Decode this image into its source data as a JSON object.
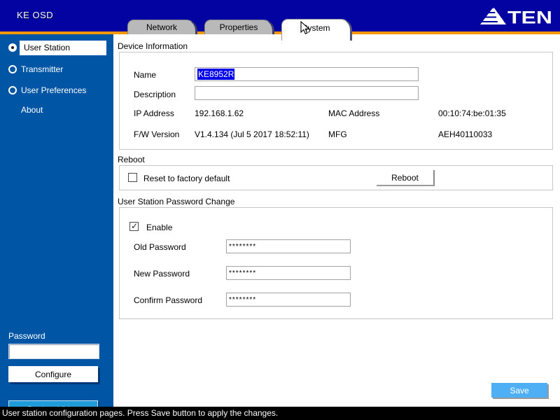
{
  "header": {
    "title": "KE OSD",
    "logo": "ATEN",
    "tabs": [
      {
        "label": "Network",
        "active": false
      },
      {
        "label": "Properties",
        "active": false
      },
      {
        "label": "System",
        "active": true
      }
    ]
  },
  "sidebar": {
    "nav": [
      {
        "label": "User Station",
        "type": "radio",
        "selected": true
      },
      {
        "label": "Transmitter",
        "type": "radio",
        "selected": false
      },
      {
        "label": "User Preferences",
        "type": "radio",
        "selected": false
      },
      {
        "label": "About",
        "type": "link"
      }
    ],
    "password_label": "Password",
    "password_value": "",
    "configure_button": "Configure",
    "back_to_video_button": "Back to Video"
  },
  "device_information": {
    "section_title": "Device Information",
    "name_label": "Name",
    "name_value": "KE8952R",
    "name_selected": true,
    "description_label": "Description",
    "description_value": "",
    "ip_label": "IP Address",
    "ip_value": "192.168.1.62",
    "mac_label": "MAC Address",
    "mac_value": "00:10:74:be:01:35",
    "fw_label": "F/W Version",
    "fw_value": "V1.4.134  (Jul  5 2017 18:52:11)",
    "mfg_label": "MFG",
    "mfg_value": "AEH40110033"
  },
  "reboot": {
    "section_title": "Reboot",
    "checkbox_label": "Reset to factory default",
    "checkbox_checked": false,
    "button_label": "Reboot"
  },
  "password_change": {
    "section_title": "User Station Password Change",
    "enable_label": "Enable",
    "enable_checked": true,
    "old_label": "Old Password",
    "old_value": "********",
    "new_label": "New Password",
    "new_value": "********",
    "confirm_label": "Confirm Password",
    "confirm_value": "********"
  },
  "save_button": "Save",
  "status_bar": "User station configuration pages. Press Save button to apply the changes.",
  "colors": {
    "header_navy": "#0203A0",
    "accent_orange": "#F39800",
    "sidebar_blue": "#0056A4",
    "tab_gray": "#B9B9B9",
    "selection_blue": "#0000E8",
    "save_blue": "#4FAFF5",
    "back_to_video_blue": "#1F9CD8"
  }
}
